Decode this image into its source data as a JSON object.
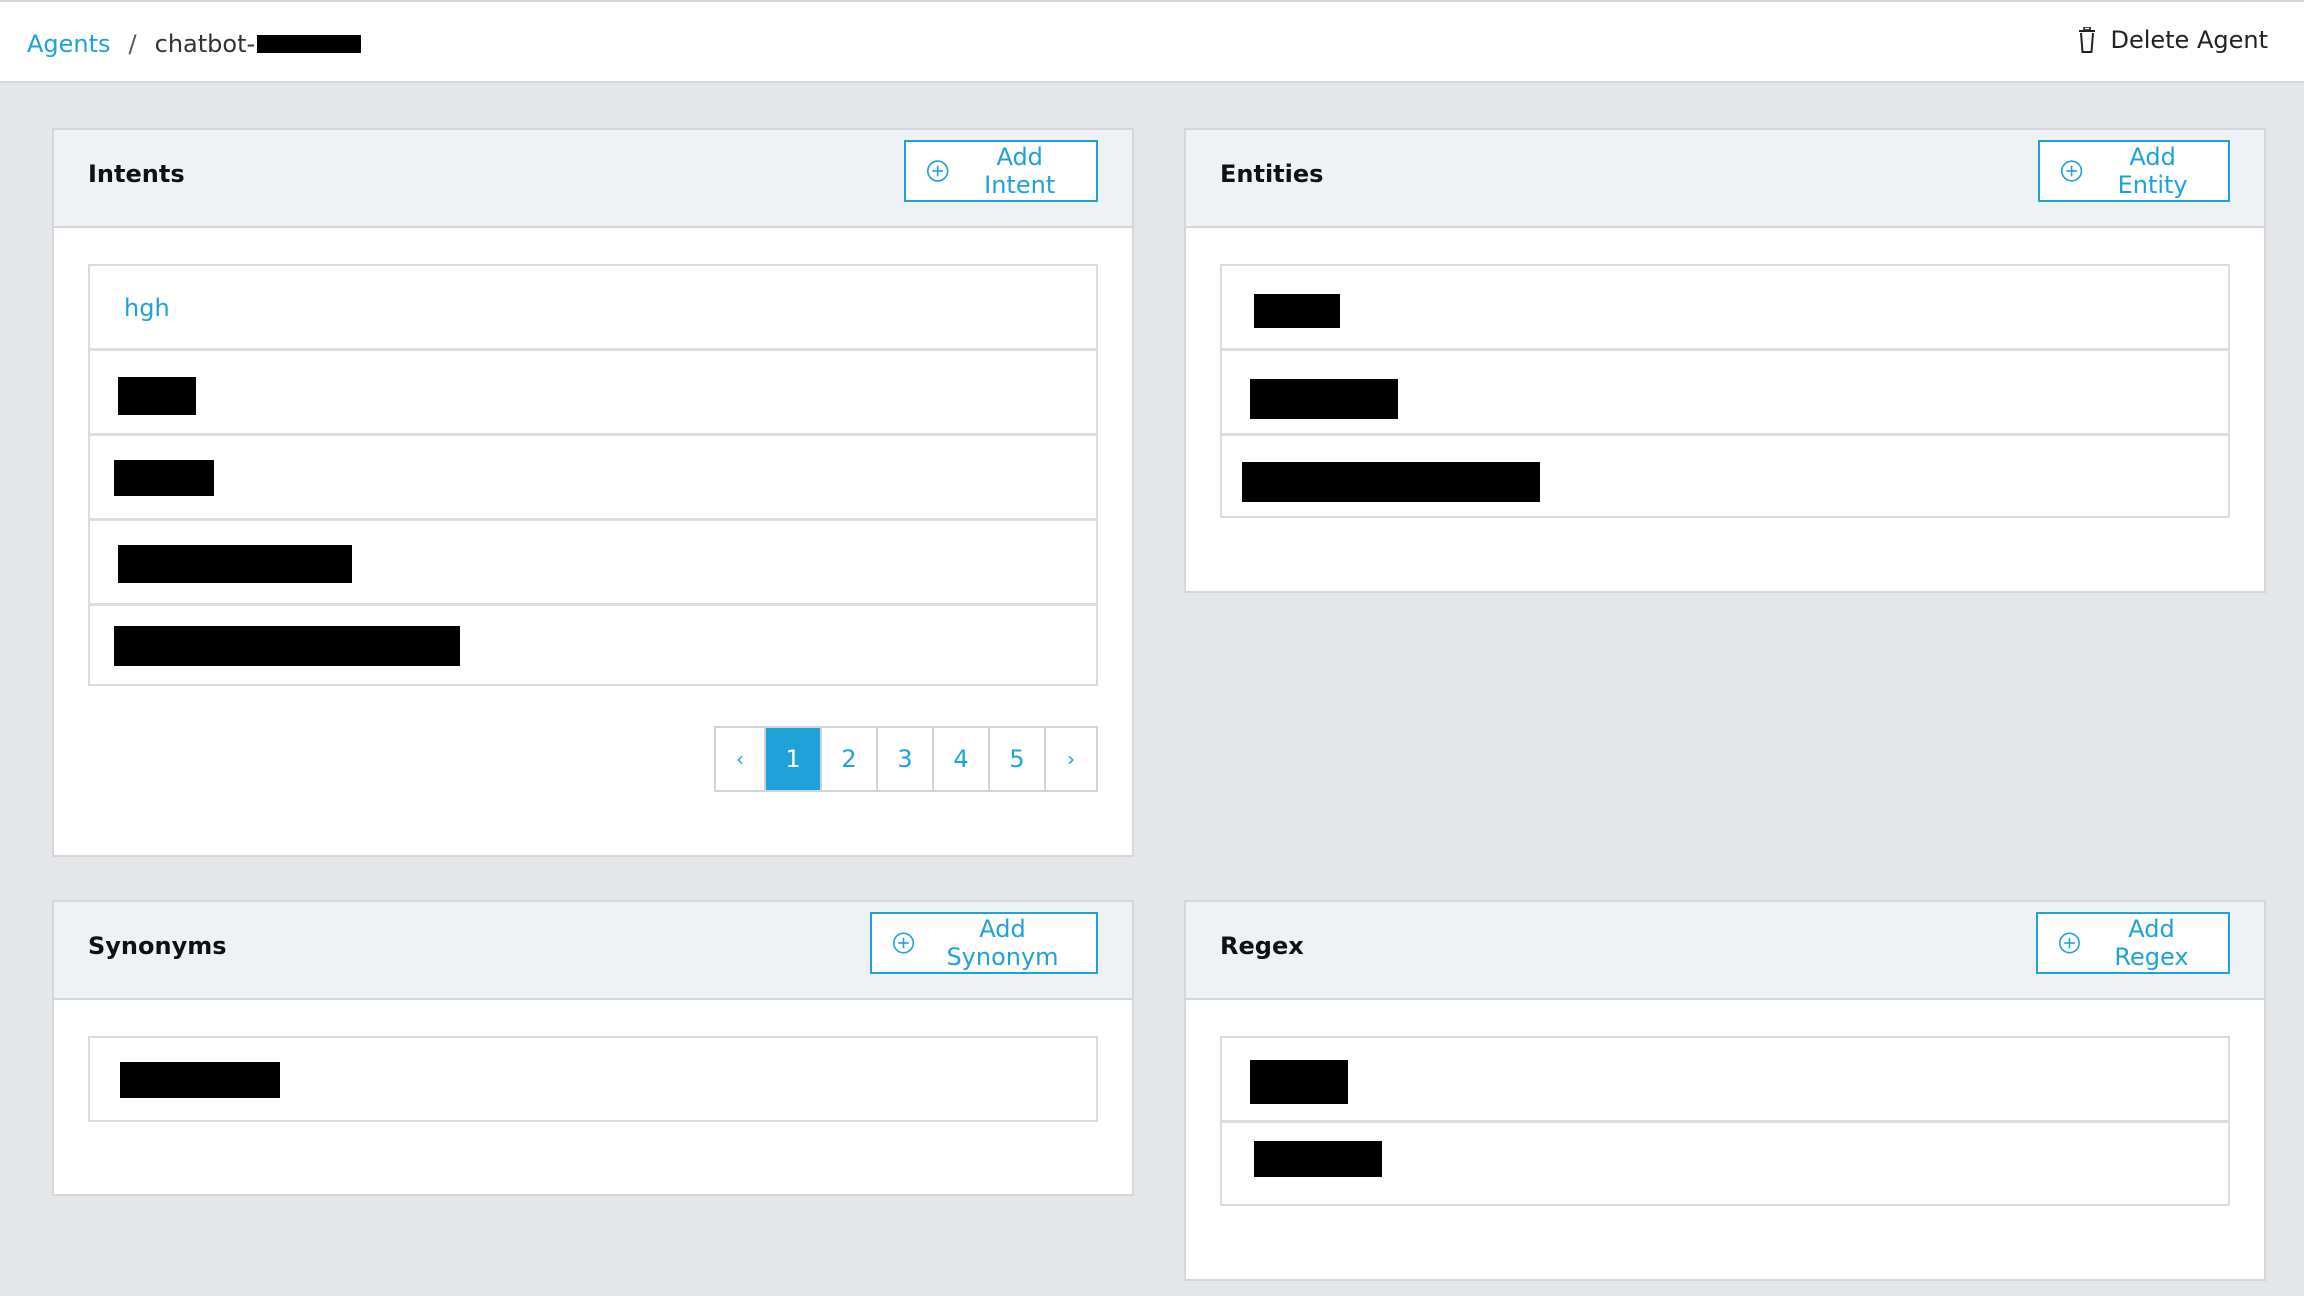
{
  "breadcrumb": {
    "root": "Agents",
    "separator": "/",
    "current": "chatbot-"
  },
  "header": {
    "delete_label": "Delete Agent"
  },
  "intents": {
    "title": "Intents",
    "add_label": "Add Intent",
    "items": [
      {
        "label": "hgh"
      }
    ],
    "pagination": {
      "prev": "‹",
      "next": "›",
      "pages": [
        "1",
        "2",
        "3",
        "4",
        "5"
      ],
      "current": "1"
    }
  },
  "entities": {
    "title": "Entities",
    "add_label": "Add Entity"
  },
  "synonyms": {
    "title": "Synonyms",
    "add_label": "Add Synonym"
  },
  "regex": {
    "title": "Regex",
    "add_label": "Add Regex"
  },
  "colors": {
    "accent": "#1fa2d8",
    "background": "#e4e6e8",
    "panel_header": "#eef2f5"
  }
}
